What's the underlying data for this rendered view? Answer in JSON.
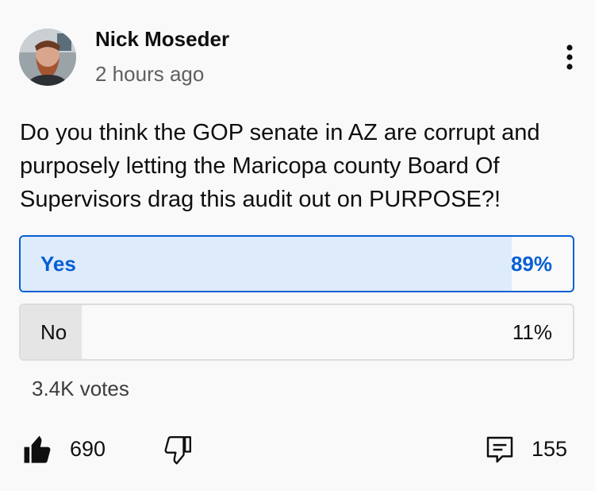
{
  "post": {
    "author": "Nick Moseder",
    "time": "2 hours ago",
    "text": "Do you think the GOP senate in AZ are corrupt and purposely letting the Maricopa county Board Of Supervisors drag this audit out on PURPOSE?!"
  },
  "poll": {
    "options": [
      {
        "label": "Yes",
        "percent_label": "89%",
        "percent": 89,
        "selected": true
      },
      {
        "label": "No",
        "percent_label": "11%",
        "percent": 11,
        "selected": false
      }
    ],
    "votes": "3.4K votes"
  },
  "actions": {
    "like_count": "690",
    "comment_count": "155"
  },
  "colors": {
    "accent": "#065fd4",
    "selected_fill": "#deebfb",
    "unselected_fill": "#e5e5e5",
    "background": "#f9f9f9"
  },
  "icons": {
    "menu": "more-vert-icon",
    "like": "thumb-up-filled-icon",
    "dislike": "thumb-down-outline-icon",
    "comment": "comment-icon"
  }
}
